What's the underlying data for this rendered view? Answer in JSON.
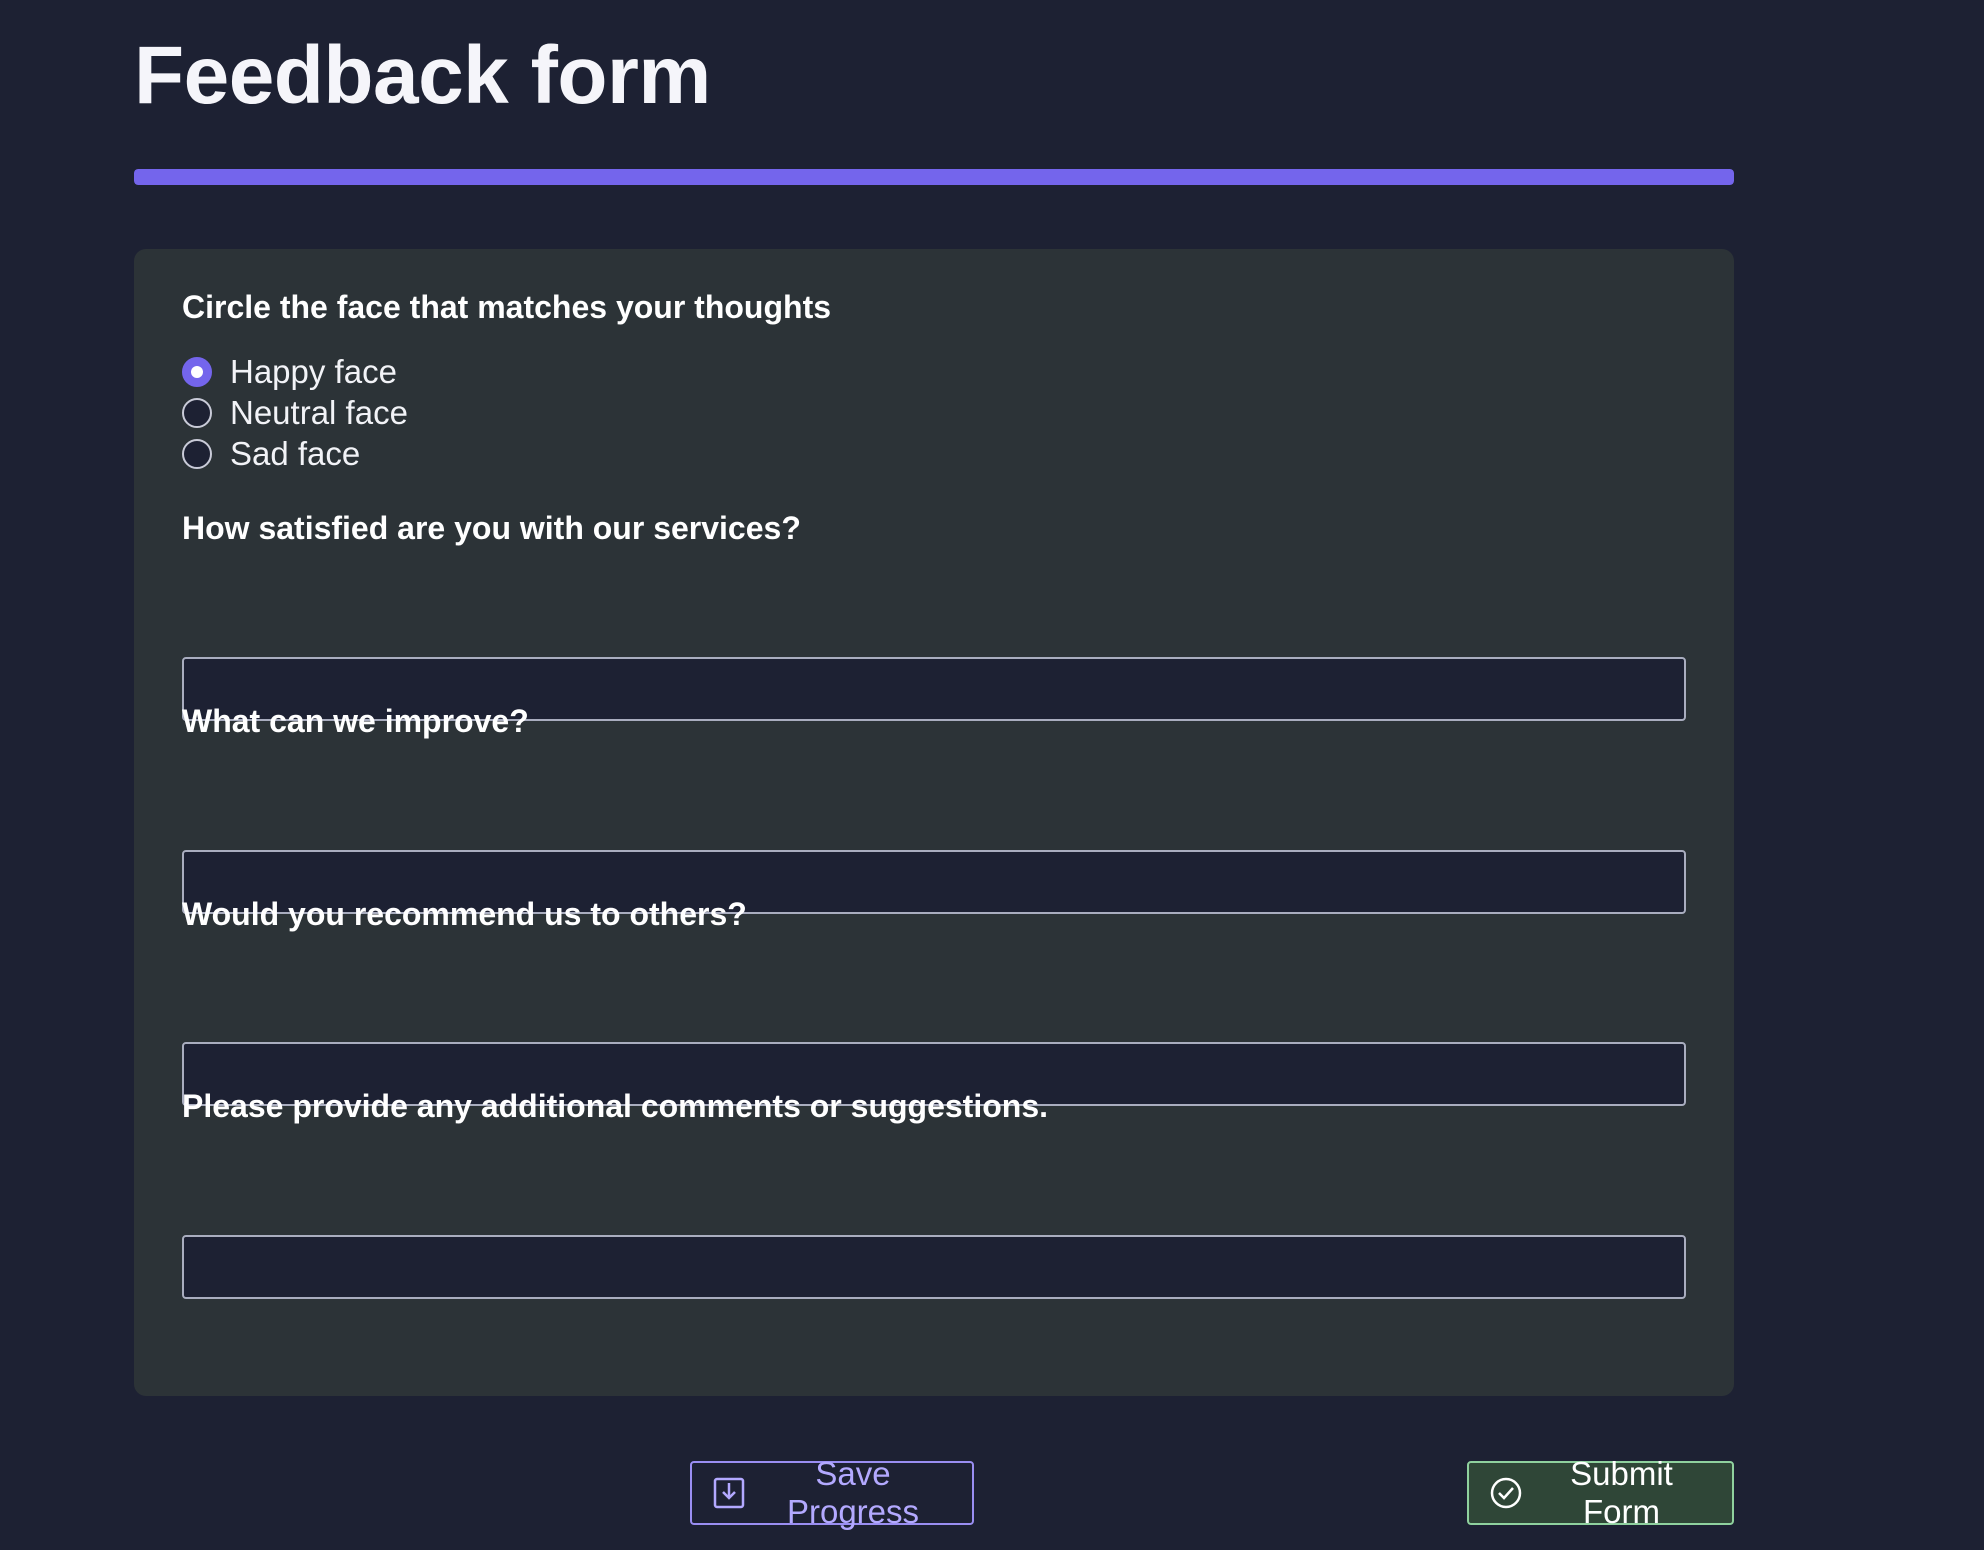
{
  "page": {
    "title": "Feedback form"
  },
  "progress": {
    "percent": 100,
    "color": "#7465ec"
  },
  "questions": {
    "face": {
      "label": "Circle the face that matches your thoughts",
      "options": [
        "Happy face",
        "Neutral face",
        "Sad face"
      ],
      "selected": "Happy face"
    },
    "satisfaction": {
      "label": "How satisfied are you with our services?",
      "value": "",
      "placeholder": ""
    },
    "improve": {
      "label": "What can we improve?",
      "value": "",
      "placeholder": ""
    },
    "recommend": {
      "label": "Would you recommend us to others?",
      "value": "",
      "placeholder": ""
    },
    "comments": {
      "label": "Please provide any additional comments or suggestions.",
      "value": "",
      "placeholder": ""
    }
  },
  "actions": {
    "save_label": "Save Progress",
    "save_icon": "download-icon",
    "submit_label": "Submit Form",
    "submit_icon": "checkmark-circle-icon"
  },
  "colors": {
    "background": "#1d2133",
    "card": "#2c3337",
    "accent": "#7465ec",
    "save_border": "#9a8ef2",
    "submit_border": "#8fd19e"
  }
}
